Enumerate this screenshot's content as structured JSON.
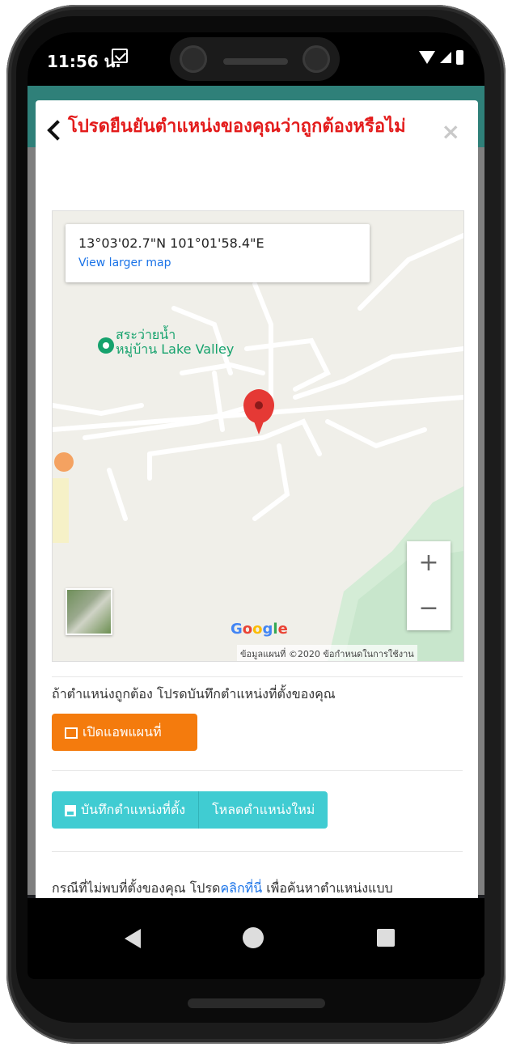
{
  "status_bar": {
    "time": "11:56 น."
  },
  "modal": {
    "title": "โปรดยืนยันตำแหน่งของคุณว่าถูกต้องหรือไม่",
    "close": "×"
  },
  "map": {
    "coordinates": "13°03'02.7\"N 101°01'58.4\"E",
    "view_larger": "View larger map",
    "poi_line1": "สระว่ายน้ำ",
    "poi_line2": "หมู่บ้าน Lake Valley",
    "zoom_in": "+",
    "zoom_out": "−",
    "google": "Google",
    "footer": "ข้อมูลแผนที่ ©2020   ข้อกำหนดในการใช้งาน"
  },
  "instructions": {
    "confirm_text": "ถ้าตำแหน่งถูกต้อง โปรดบันทึกตำแหน่งที่ตั้งของคุณ",
    "open_map_button": "เปิดแอพแผนที่",
    "save_button": "บันทึกตำแหน่งที่ตั้ง",
    "reload_button": "โหลดตำแหน่งใหม่",
    "not_found_prefix": "กรณีที่ไม่พบที่ตั้งของคุณ โปรด",
    "not_found_link": "คลิกที่นี่",
    "not_found_suffix": " เพื่อค้นหาตำแหน่งแบบ"
  },
  "colors": {
    "title_red": "#e31b1b",
    "orange": "#f47b0d",
    "teal": "#40ccd2",
    "pin_red": "#e53935",
    "poi_green": "#16a26d"
  }
}
